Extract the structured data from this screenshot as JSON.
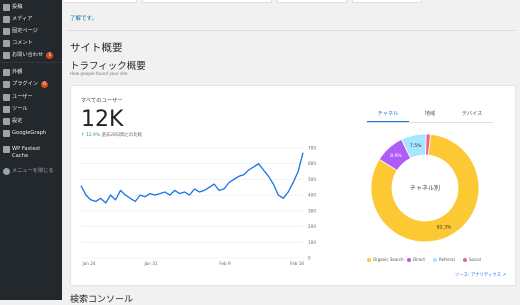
{
  "sidebar": {
    "items": [
      {
        "label": "投稿",
        "icon": "pin-icon"
      },
      {
        "label": "メディア",
        "icon": "media-icon"
      },
      {
        "label": "固定ページ",
        "icon": "page-icon"
      },
      {
        "label": "コメント",
        "icon": "comment-icon"
      },
      {
        "label": "お問い合わせ",
        "icon": "mail-icon",
        "badge": "1"
      },
      {
        "label": "外観",
        "icon": "brush-icon"
      },
      {
        "label": "プラグイン",
        "icon": "plugin-icon",
        "badge": "6"
      },
      {
        "label": "ユーザー",
        "icon": "user-icon"
      },
      {
        "label": "ツール",
        "icon": "wrench-icon"
      },
      {
        "label": "設定",
        "icon": "settings-icon"
      },
      {
        "label": "GoogleGraph",
        "icon": "graph-icon"
      },
      {
        "label": "WP Fastest",
        "label2": "Cache",
        "icon": "cache-icon"
      }
    ],
    "collapse": "メニューを閉じる"
  },
  "notice_link": "了解です。",
  "page": {
    "title": "サイト概要",
    "section": "トラフィック概要",
    "subtitle": "How people found your site"
  },
  "users_card": {
    "title": "すべてのユーザー",
    "value": "12K",
    "change_pct": "↑ 12.9%",
    "change_text": "過去28日間との比較"
  },
  "tabs": [
    "チャネル",
    "地域",
    "デバイス"
  ],
  "source_link": "ソース: アナリティクス",
  "next_section": "検索コンソール",
  "colors": {
    "line": "#1a73e8",
    "organic": "#fcc934",
    "direct": "#af5cf7",
    "referral": "#a6e7ff",
    "social": "#f06292"
  },
  "chart_data": [
    {
      "type": "line",
      "title": "",
      "xlabel": "",
      "ylabel": "",
      "x_ticks": [
        "Jan 24",
        "Jan 31",
        "Feb 9",
        "Feb 16"
      ],
      "y_ticks": [
        0,
        100,
        200,
        300,
        400,
        500,
        600,
        700
      ],
      "ylim": [
        0,
        700
      ],
      "grid": true,
      "series": [
        {
          "values": [
            460,
            400,
            370,
            360,
            380,
            350,
            400,
            370,
            430,
            400,
            380,
            360,
            400,
            390,
            410,
            400,
            410,
            420,
            400,
            430,
            410,
            420,
            400,
            440,
            420,
            430,
            450,
            470,
            430,
            440,
            480,
            500,
            520,
            530,
            560,
            580,
            600,
            560,
            520,
            470,
            400,
            380,
            420,
            480,
            550,
            670
          ]
        }
      ]
    },
    {
      "type": "pie",
      "title": "チャネル別",
      "labels": [
        "Organic Search",
        "Direct",
        "Referral",
        "Social"
      ],
      "values": [
        82.3,
        8.9,
        7.5,
        1.3
      ],
      "data_labels": [
        "82.3%",
        "8.9%",
        "7.5%",
        ""
      ],
      "legend_position": "bottom"
    }
  ]
}
